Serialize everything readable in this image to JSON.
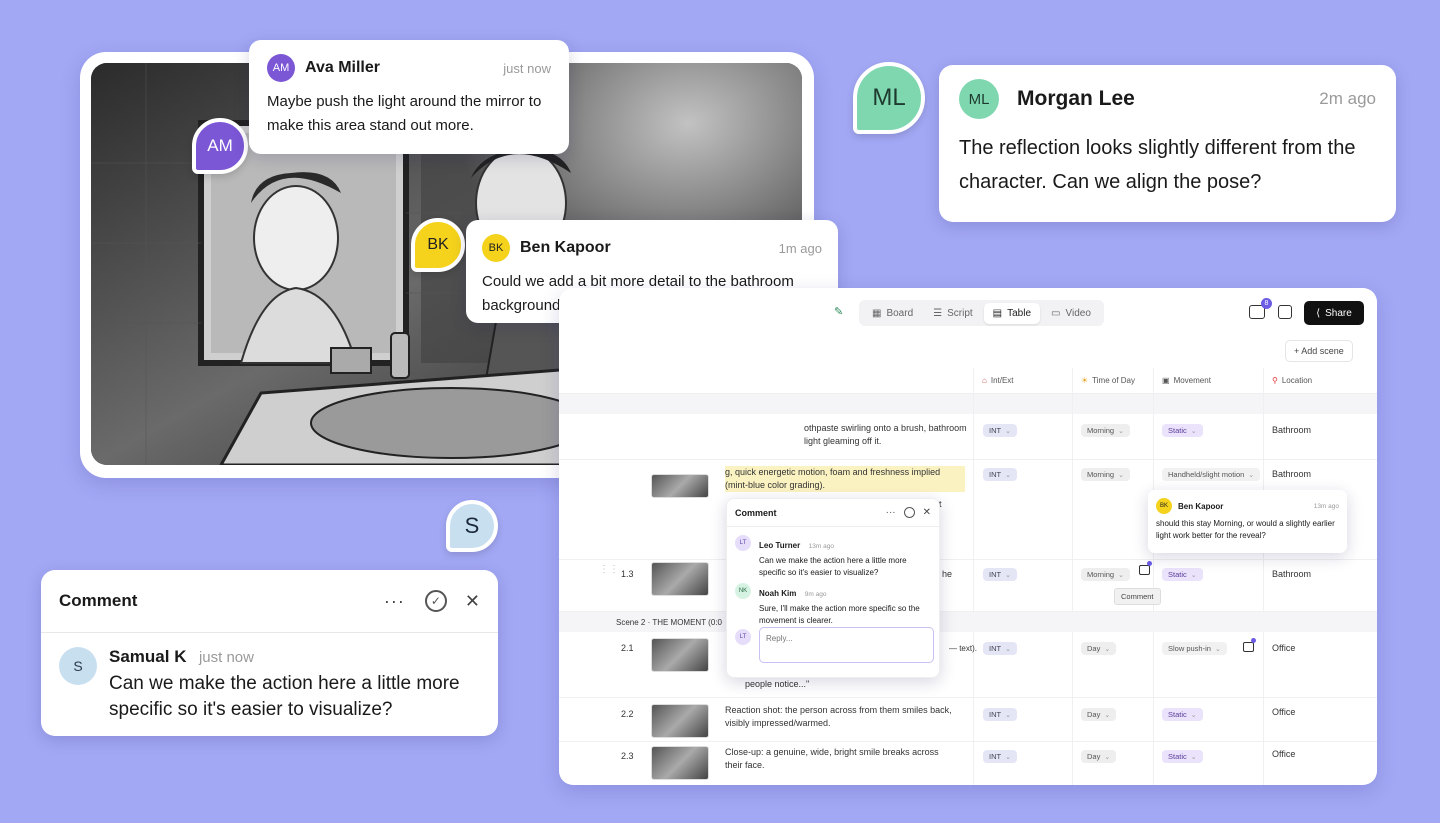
{
  "colors": {
    "background": "#a3a8f5",
    "ava": "#7b57d6",
    "ben": "#f5d31c",
    "morgan": "#7fd7b0",
    "samual": "#c8dff0"
  },
  "ava_comment": {
    "initials": "AM",
    "name": "Ava Miller",
    "time": "just now",
    "text": "Maybe push the light around the mirror to make this area stand out more."
  },
  "ben_comment": {
    "initials": "BK",
    "name": "Ben Kapoor",
    "time": "1m ago",
    "text": "Could we add a bit more detail to the bathroom background?"
  },
  "morgan_comment": {
    "initials": "ML",
    "name": "Morgan Lee",
    "time": "2m ago",
    "text": "The reflection looks slightly different from the character. Can we align the pose?"
  },
  "samual_comment": {
    "bubble_initial": "S",
    "title": "Comment",
    "initials": "S",
    "name": "Samual K",
    "time": "just now",
    "text": "Can we make the action here a little more specific so it's easier to visualize?"
  },
  "table_panel": {
    "tabs": [
      {
        "label": "Board",
        "icon": "board-icon"
      },
      {
        "label": "Script",
        "icon": "script-icon"
      },
      {
        "label": "Table",
        "icon": "table-icon"
      },
      {
        "label": "Video",
        "icon": "video-icon"
      }
    ],
    "notif_count": "8",
    "share_label": "Share",
    "add_scene_label": "+ Add scene",
    "columns": {
      "intext": "Int/Ext",
      "tod": "Time of Day",
      "movement": "Movement",
      "location": "Location"
    },
    "row1": {
      "desc": "othpaste swirling onto a brush, bathroom light gleaming off it.",
      "intext": "INT",
      "tod": "Morning",
      "movement": "Static",
      "location": "Bathroom"
    },
    "row2": {
      "desc": "g, quick energetic motion, foam and freshness implied (mint-blue color grading).",
      "intext": "INT",
      "tod": "Morning",
      "movement": "Handheld/slight motion",
      "location": "Bathroom"
    },
    "row3": {
      "num": "1.3",
      "intext": "INT",
      "tod": "Morning",
      "movement": "Static",
      "location": "Bathroom",
      "tooltip": "Comment"
    },
    "scene2_label": "Scene 2 · THE MOMENT (0:0",
    "row4": {
      "num": "2.1",
      "desc_tail": "people notice...\"",
      "intext": "INT",
      "tod": "Day",
      "movement": "Slow push-in",
      "location": "Office"
    },
    "row5": {
      "num": "2.2",
      "desc": "Reaction shot: the person across from them smiles back, visibly impressed/warmed.",
      "intext": "INT",
      "tod": "Day",
      "movement": "Static",
      "location": "Office"
    },
    "row6": {
      "num": "2.3",
      "desc": "Close-up: a genuine, wide, bright smile breaks across their face.",
      "intext": "INT",
      "tod": "Day",
      "movement": "Static",
      "location": "Office"
    },
    "frag": {
      "t": "t",
      "he": "he",
      "text_paren": "— text)."
    }
  },
  "thread": {
    "title": "Comment",
    "c1": {
      "initials": "LT",
      "name": "Leo Turner",
      "time": "13m ago",
      "text": "Can we make the action here a little more specific so it's easier to visualize?"
    },
    "c2": {
      "initials": "NK",
      "name": "Noah Kim",
      "time": "9m ago",
      "text": "Sure, I'll make the action more specific so the movement is clearer."
    },
    "reply_initials": "LT",
    "reply_placeholder": "Reply..."
  },
  "ben_table_comment": {
    "initials": "BK",
    "name": "Ben Kapoor",
    "time": "13m ago",
    "text": "should this stay Morning, or would a slightly earlier light work better for the reveal?"
  }
}
